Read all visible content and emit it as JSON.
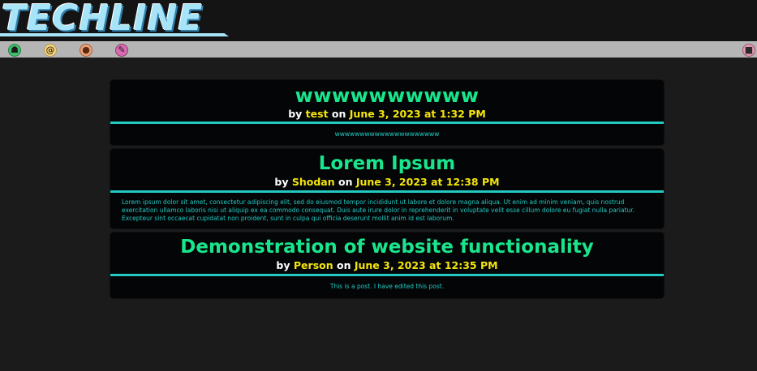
{
  "header": {
    "logo_text": "TECHLINE"
  },
  "nav": {
    "items": [
      {
        "icon": "home-icon"
      },
      {
        "icon": "at-icon"
      },
      {
        "icon": "user-icon"
      },
      {
        "icon": "pencil-icon"
      }
    ],
    "right_icon": "lock-icon"
  },
  "posts": [
    {
      "title": "wwwwwwwwww",
      "by_word": "by",
      "author": "test",
      "on_word": "on",
      "date": "June 3, 2023 at 1:32 PM",
      "body": "wwwwwwwwwwwwwwwwwwwww"
    },
    {
      "title": "Lorem Ipsum",
      "by_word": "by",
      "author": "Shodan",
      "on_word": "on",
      "date": "June 3, 2023 at 12:38 PM",
      "body": "Lorem ipsum dolor sit amet, consectetur adipiscing elit, sed do eiusmod tempor incididunt ut labore et dolore magna aliqua. Ut enim ad minim veniam, quis nostrud exercitation ullamco laboris nisi ut aliquip ex ea commodo consequat. Duis aute irure dolor in reprehenderit in voluptate velit esse cillum dolore eu fugiat nulla pariatur. Excepteur sint occaecat cupidatat non proident, sunt in culpa qui officia deserunt mollit anim id est laborum."
    },
    {
      "title": "Demonstration of website functionality",
      "by_word": "by",
      "author": "Person",
      "on_word": "on",
      "date": "June 3, 2023 at 12:35 PM",
      "body": "This is a post. I have edited this post."
    }
  ],
  "colors": {
    "title": "#19e68c",
    "accent": "#23c9c0",
    "meta_highlight": "#f5e50a",
    "navbar": "#b5b5b5",
    "background": "#1b1b1b"
  }
}
